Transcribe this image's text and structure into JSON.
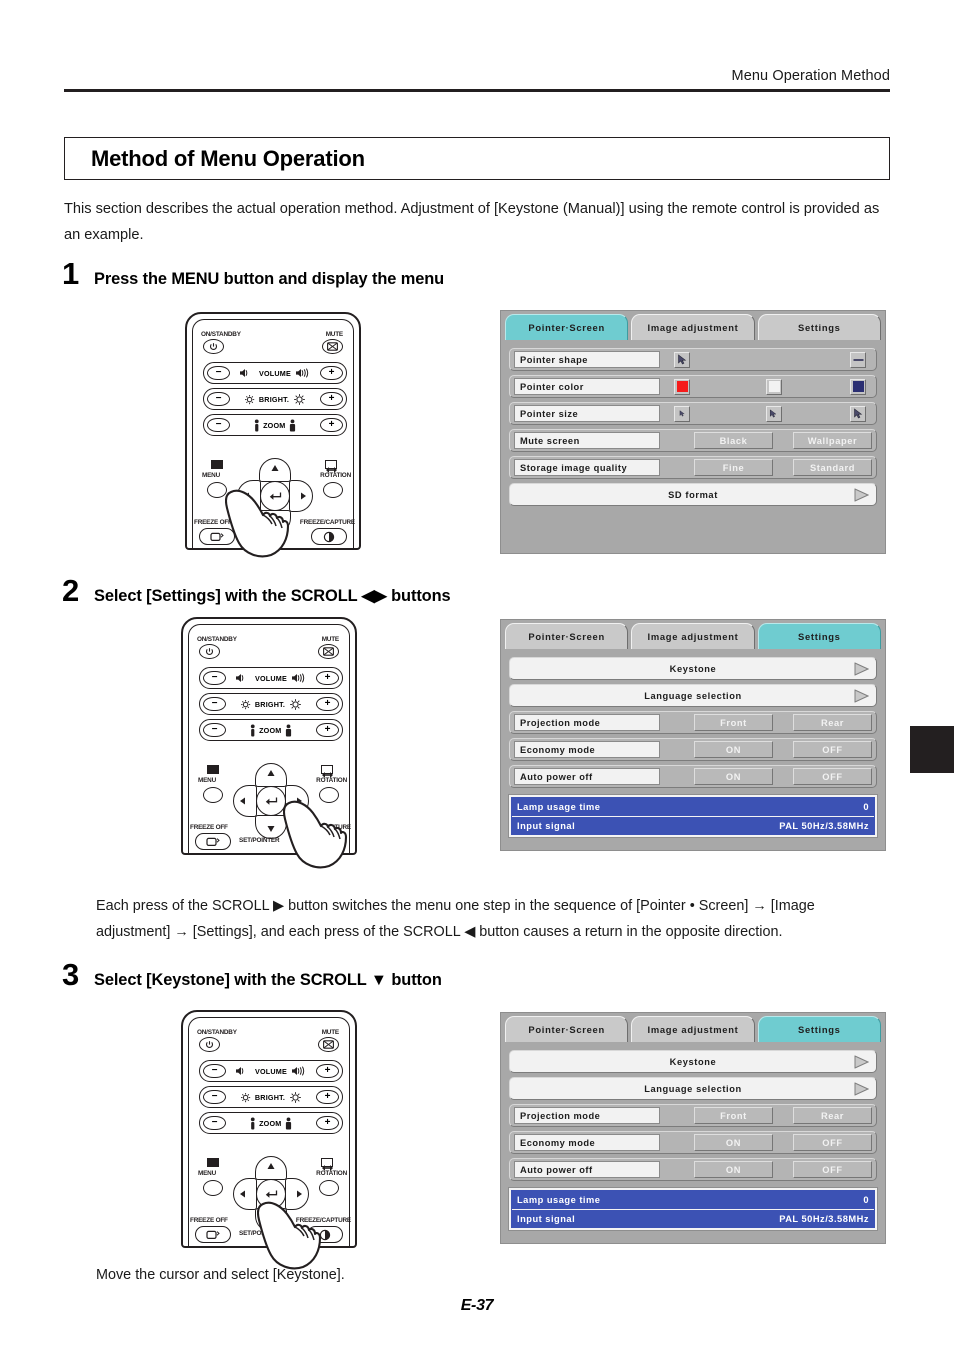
{
  "header": {
    "title": "Menu Operation Method"
  },
  "page_title": "Method of Menu Operation",
  "intro": "This section describes the actual operation method. Adjustment of [Keystone (Manual)] using the remote control is provided as an example.",
  "steps": [
    {
      "num": "1",
      "text": "Press the MENU button and display the menu"
    },
    {
      "num": "2",
      "text": "Select [Settings] with the SCROLL ◀▶ buttons"
    },
    {
      "num": "3",
      "text": "Select [Keystone] with the SCROLL ▼ button"
    }
  ],
  "paragraphs": {
    "sequence": "Each press of the SCROLL ▶ button switches the menu one step in the sequence of [Pointer • Screen] → [Image adjustment] → [Settings], and each press of the SCROLL ◀ button causes a return in the opposite direction.",
    "move_cursor": "Move the cursor and select [Keystone]."
  },
  "page_number": "E-37",
  "remote": {
    "on_standby": "ON/STANDBY",
    "mute": "MUTE",
    "volume": "VOLUME",
    "bright": "BRIGHT.",
    "zoom": "ZOOM",
    "menu": "MENU",
    "rotation": "ROTATION",
    "freeze_off": "FREEZE OFF",
    "set_pointer": "SET/POINTER",
    "freeze_capture": "FREEZE/CAPTURE",
    "minus": "−",
    "plus": "+",
    "enter_glyph": "↵"
  },
  "osd": {
    "tabs": [
      {
        "label": "Pointer·Screen"
      },
      {
        "label": "Image adjustment"
      },
      {
        "label": "Settings"
      }
    ],
    "active_tab_color": "#6fccd0",
    "pointer_screen": {
      "rows": [
        {
          "label": "Pointer shape",
          "kind": "icons",
          "icons": [
            "cursor-arrow-icon",
            "dash-icon"
          ]
        },
        {
          "label": "Pointer color",
          "kind": "colors",
          "colors": [
            "#f51b1b",
            "#f2f2f2",
            "#2b2f72"
          ]
        },
        {
          "label": "Pointer size",
          "kind": "icons3",
          "icons": [
            "cursor-small-icon",
            "cursor-medium-icon",
            "cursor-large-icon"
          ]
        },
        {
          "label": "Mute screen",
          "kind": "buttons",
          "options": [
            "Black",
            "Wallpaper"
          ]
        },
        {
          "label": "Storage image quality",
          "kind": "buttons",
          "options": [
            "Fine",
            "Standard"
          ]
        }
      ],
      "sd_format": "SD format"
    },
    "settings": {
      "keystone": "Keystone",
      "language_selection": "Language selection",
      "rows": [
        {
          "label": "Projection mode",
          "options": [
            "Front",
            "Rear"
          ]
        },
        {
          "label": "Economy mode",
          "options": [
            "ON",
            "OFF"
          ]
        },
        {
          "label": "Auto power off",
          "options": [
            "ON",
            "OFF"
          ]
        }
      ],
      "info": [
        {
          "label": "Lamp usage time",
          "value": "0"
        },
        {
          "label": "Input signal",
          "value": "PAL 50Hz/3.58MHz"
        }
      ],
      "info_color": "#3c52b4"
    }
  }
}
